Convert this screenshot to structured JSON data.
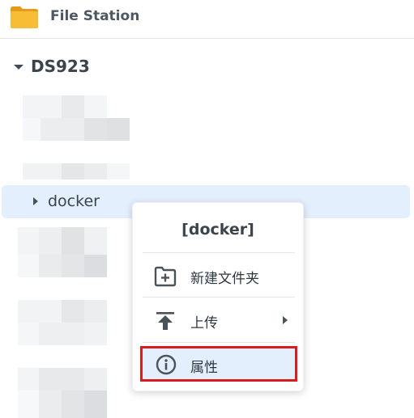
{
  "header": {
    "app_title": "File Station",
    "app_icon": "folder-icon"
  },
  "tree": {
    "root": {
      "label": "DS923",
      "expanded": true
    },
    "selected_folder": {
      "label": "docker",
      "expanded": false
    }
  },
  "context_menu": {
    "title": "[docker]",
    "items": [
      {
        "label": "新建文件夹",
        "icon": "new-folder-icon"
      },
      {
        "label": "上传",
        "icon": "upload-icon",
        "has_submenu": true
      },
      {
        "label": "属性",
        "icon": "info-icon",
        "highlighted": true
      }
    ]
  },
  "colors": {
    "selection_bg": "#e4effd",
    "highlight_border": "#d91c1c",
    "folder_yellow": "#f6b32b"
  }
}
